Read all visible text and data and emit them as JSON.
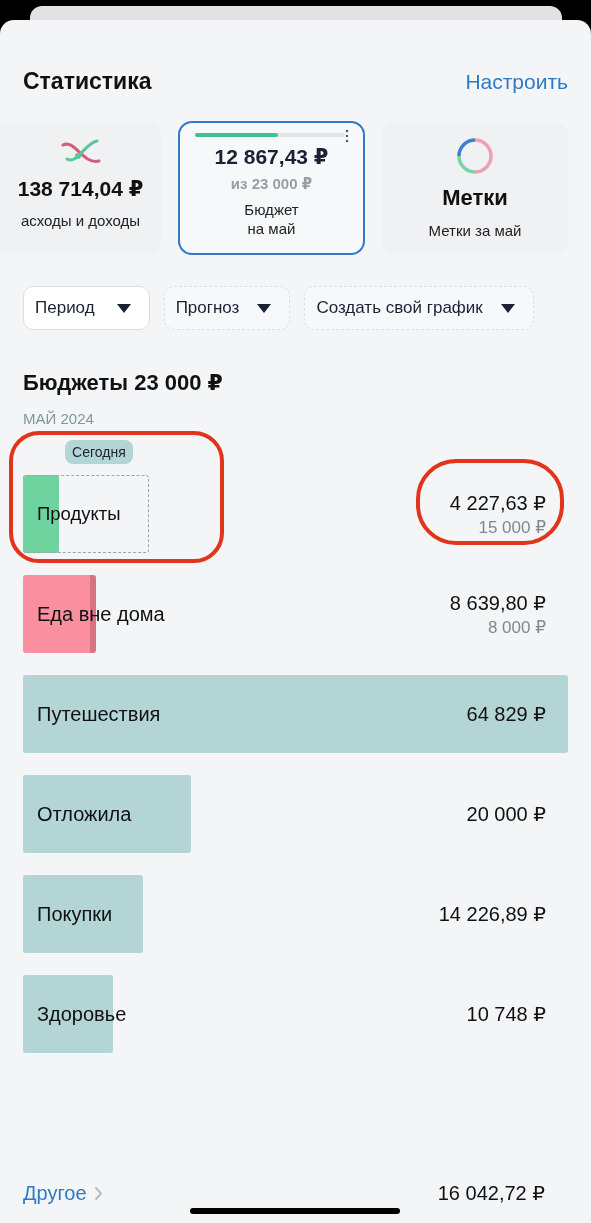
{
  "header": {
    "title": "Статистика",
    "action": "Настроить"
  },
  "cards": [
    {
      "kind": "flow",
      "value": "138 714,04 ₽",
      "caption": "асходы и доходы",
      "selected": false
    },
    {
      "kind": "budget",
      "level": 0.55,
      "value": "12 867,43 ₽",
      "subvalue": "из 23 000 ₽",
      "caption": "Бюджет\nна май",
      "selected": true
    },
    {
      "kind": "tags",
      "value": "Метки",
      "caption": "Метки за май",
      "selected": false
    }
  ],
  "filters": [
    {
      "label": "Период",
      "dashed": false
    },
    {
      "label": "Прогноз",
      "dashed": true
    },
    {
      "label": "Создать свой график",
      "dashed": true
    }
  ],
  "budgets": {
    "title": "Бюджеты 23 000 ₽",
    "month": "МАЙ 2024",
    "today_label": "Сегодня",
    "rows": [
      {
        "name": "Продукты",
        "amount": "4 227,63 ₽",
        "limit": "15 000 ₽",
        "color": "#6fd3a0",
        "highlight": true
      },
      {
        "name": "Еда вне дома",
        "amount": "8 639,80 ₽",
        "limit": "8 000 ₽",
        "color": "#f98f9f",
        "highlight": false
      },
      {
        "name": "Путешествия",
        "amount": "64 829 ₽",
        "color": "#b3d5d6",
        "highlight": false
      },
      {
        "name": "Отложила",
        "amount": "20 000 ₽",
        "color": "#b3d5d6",
        "highlight": false
      },
      {
        "name": "Покупки",
        "amount": "14 226,89 ₽",
        "color": "#b3d5d6",
        "highlight": false
      },
      {
        "name": "Здоровье",
        "amount": "10 748 ₽",
        "color": "#b3d5d6",
        "highlight": false
      }
    ],
    "other": {
      "label": "Другое",
      "amount": "16 042,72 ₽"
    }
  }
}
